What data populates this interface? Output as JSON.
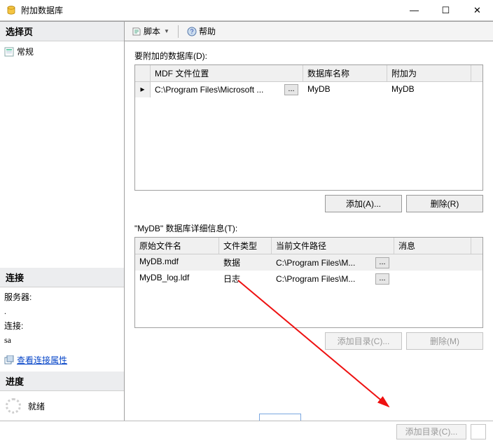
{
  "window": {
    "title": "附加数据库",
    "min": "—",
    "max": "☐",
    "close": "✕"
  },
  "left": {
    "select_page": "选择页",
    "general": "常规",
    "connection_head": "连接",
    "server_label": "服务器:",
    "server_value": ".",
    "conn_label": "连接:",
    "conn_value": "sa",
    "view_conn_props": "查看连接属性",
    "progress_head": "进度",
    "progress_value": "就绪"
  },
  "toolbar": {
    "script": "脚本",
    "help": "帮助"
  },
  "main": {
    "databases_label": "要附加的数据库(D):",
    "t1_head": {
      "c1": "MDF 文件位置",
      "c2": "数据库名称",
      "c3": "附加为"
    },
    "t1_row": {
      "path": "C:\\Program Files\\Microsoft ...",
      "dbname": "MyDB",
      "attachas": "MyDB"
    },
    "add_btn": "添加(A)...",
    "remove_btn": "删除(R)",
    "details_label": "\"MyDB\" 数据库详细信息(T):",
    "t2_head": {
      "c0": "原始文件名",
      "c1": "文件类型",
      "c2": "当前文件路径",
      "c3": "消息"
    },
    "t2_rows": [
      {
        "name": "MyDB.mdf",
        "type": "数据",
        "path": "C:\\Program Files\\M..."
      },
      {
        "name": "MyDB_log.ldf",
        "type": "日志",
        "path": "C:\\Program Files\\M..."
      }
    ],
    "add_dir_btn": "添加目录(C)...",
    "remove2_btn": "删除(M)",
    "ell": "..."
  },
  "footer": {
    "add_dir": "添加目录(C)..."
  }
}
